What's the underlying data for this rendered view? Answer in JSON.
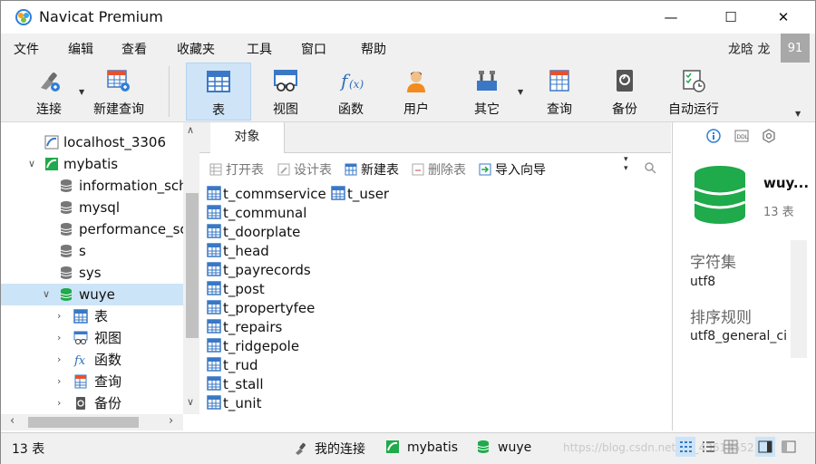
{
  "window": {
    "title": "Navicat Premium",
    "minimize": "—",
    "maximize": "☐",
    "close": "✕"
  },
  "menu": {
    "items": [
      "文件",
      "编辑",
      "查看",
      "收藏夹",
      "工具",
      "窗口",
      "帮助"
    ],
    "user": "龙晗 龙",
    "badge": "91"
  },
  "toolbar": {
    "items": [
      {
        "label": "连接",
        "icon": "connection-icon"
      },
      {
        "label": "新建查询",
        "icon": "new-query-icon"
      },
      {
        "label": "表",
        "icon": "table-icon",
        "active": true
      },
      {
        "label": "视图",
        "icon": "view-icon"
      },
      {
        "label": "函数",
        "icon": "function-icon"
      },
      {
        "label": "用户",
        "icon": "user-icon"
      },
      {
        "label": "其它",
        "icon": "tools-icon"
      },
      {
        "label": "查询",
        "icon": "query-icon"
      },
      {
        "label": "备份",
        "icon": "backup-icon"
      },
      {
        "label": "自动运行",
        "icon": "automation-icon"
      }
    ]
  },
  "tree": {
    "connection": "localhost_3306",
    "mybatis": "mybatis",
    "databases": [
      "information_schema",
      "mysql",
      "performance_schema",
      "s",
      "sys"
    ],
    "selected": "wuye",
    "children": [
      "表",
      "视图",
      "函数",
      "查询",
      "备份"
    ]
  },
  "tab": {
    "label": "对象"
  },
  "objbar": {
    "open": "打开表",
    "design": "设计表",
    "new": "新建表",
    "delete": "删除表",
    "import": "导入向导"
  },
  "tables": [
    "t_commservice",
    "t_user",
    "t_communal",
    "t_doorplate",
    "t_head",
    "t_payrecords",
    "t_post",
    "t_propertyfee",
    "t_repairs",
    "t_ridgepole",
    "t_rud",
    "t_stall",
    "t_unit"
  ],
  "info": {
    "name": "wuy...",
    "count": "13 表",
    "charset_label": "字符集",
    "charset": "utf8",
    "collation_label": "排序规则",
    "collation": "utf8_general_ci"
  },
  "status": {
    "count": "13 表",
    "conn_label": "我的连接",
    "db1": "mybatis",
    "db2": "wuye",
    "watermark": "https://blog.csdn.net/qq_43613552"
  },
  "colors": {
    "accent": "#cce4f7",
    "db_green": "#1faa4b",
    "table_blue": "#3a78c6"
  }
}
